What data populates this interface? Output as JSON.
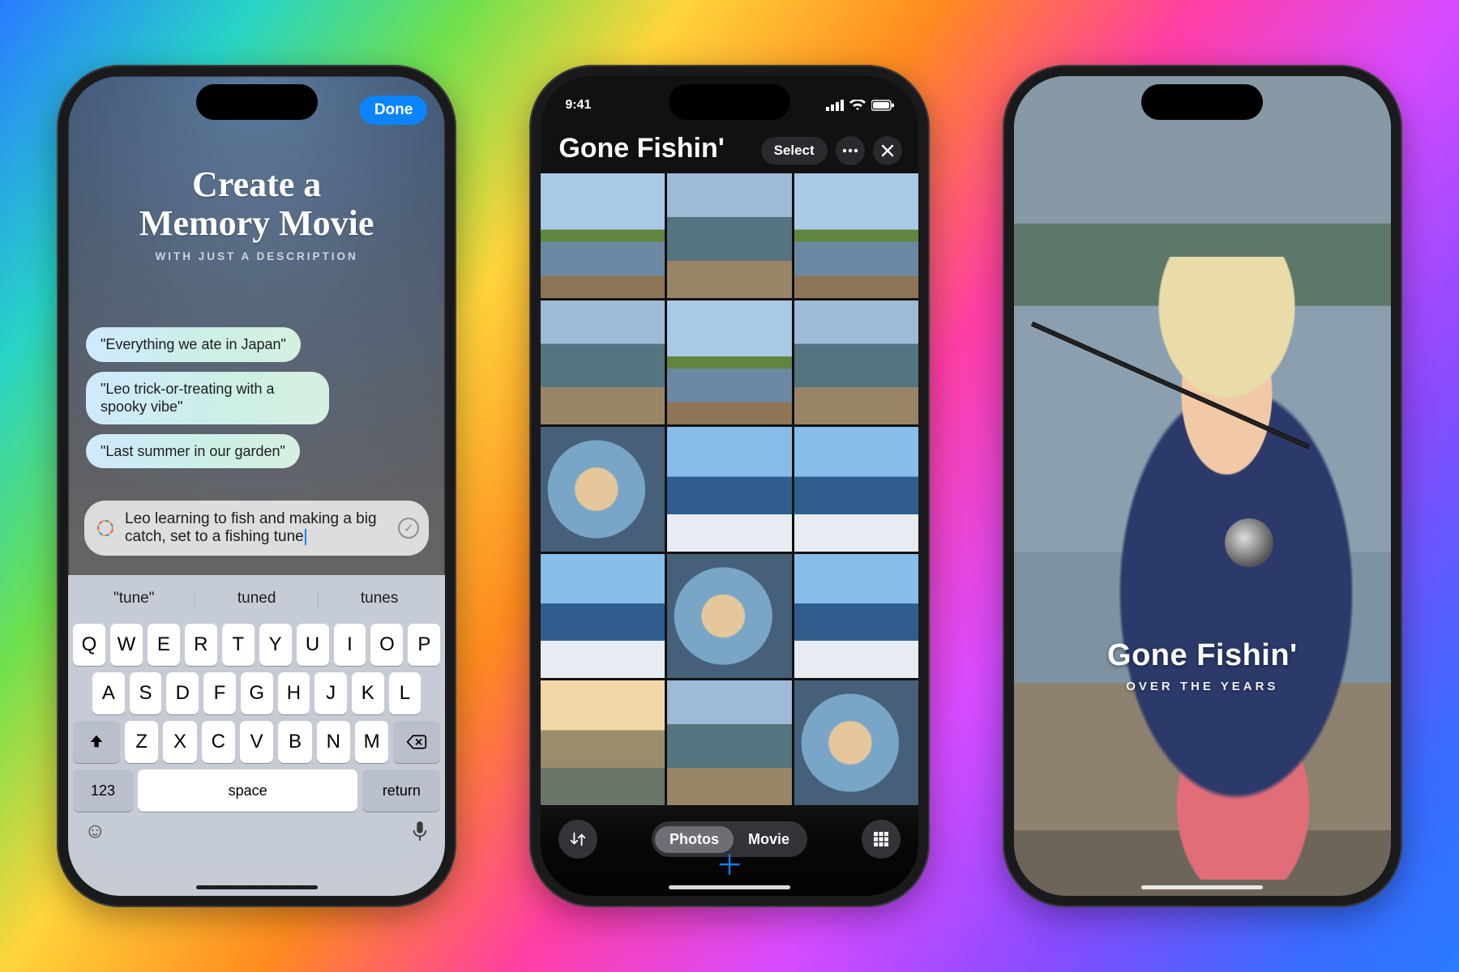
{
  "phone1": {
    "done_label": "Done",
    "title_line1": "Create a",
    "title_line2": "Memory Movie",
    "subtitle": "WITH JUST A DESCRIPTION",
    "suggestion_chips": [
      "\"Everything we ate in Japan\"",
      "\"Leo trick-or-treating with a spooky vibe\"",
      "\"Last summer in our garden\""
    ],
    "input_text": "Leo learning to fish and making a big catch, set to a fishing tune",
    "keyboard": {
      "suggestions": [
        "\"tune\"",
        "tuned",
        "tunes"
      ],
      "row1": [
        "Q",
        "W",
        "E",
        "R",
        "T",
        "Y",
        "U",
        "I",
        "O",
        "P"
      ],
      "row2": [
        "A",
        "S",
        "D",
        "F",
        "G",
        "H",
        "J",
        "K",
        "L"
      ],
      "row3": [
        "Z",
        "X",
        "C",
        "V",
        "B",
        "N",
        "M"
      ],
      "key_123": "123",
      "key_space": "space",
      "key_return": "return"
    }
  },
  "phone2": {
    "status_time": "9:41",
    "album_title": "Gone Fishin'",
    "select_label": "Select",
    "segmented": {
      "photos": "Photos",
      "movie": "Movie",
      "active": "photos"
    }
  },
  "phone3": {
    "memory_title": "Gone Fishin'",
    "memory_subtitle": "OVER THE YEARS"
  }
}
